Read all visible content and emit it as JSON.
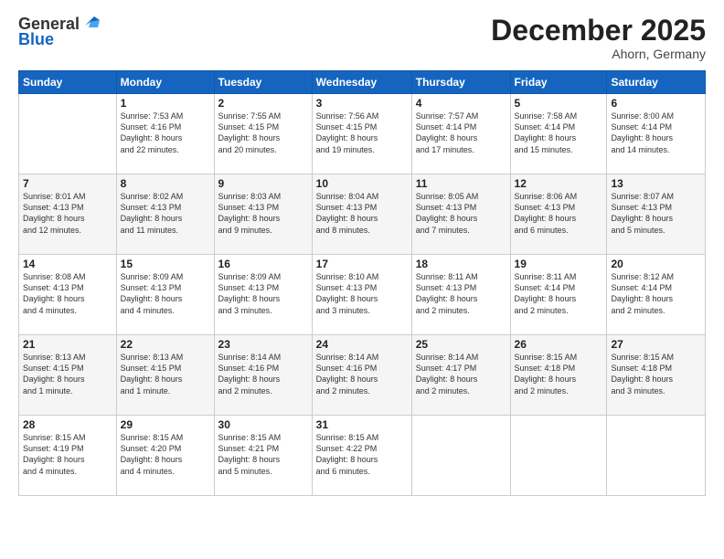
{
  "logo": {
    "line1": "General",
    "line2": "Blue"
  },
  "title": "December 2025",
  "location": "Ahorn, Germany",
  "days_of_week": [
    "Sunday",
    "Monday",
    "Tuesday",
    "Wednesday",
    "Thursday",
    "Friday",
    "Saturday"
  ],
  "weeks": [
    [
      {
        "num": "",
        "info": ""
      },
      {
        "num": "1",
        "info": "Sunrise: 7:53 AM\nSunset: 4:16 PM\nDaylight: 8 hours\nand 22 minutes."
      },
      {
        "num": "2",
        "info": "Sunrise: 7:55 AM\nSunset: 4:15 PM\nDaylight: 8 hours\nand 20 minutes."
      },
      {
        "num": "3",
        "info": "Sunrise: 7:56 AM\nSunset: 4:15 PM\nDaylight: 8 hours\nand 19 minutes."
      },
      {
        "num": "4",
        "info": "Sunrise: 7:57 AM\nSunset: 4:14 PM\nDaylight: 8 hours\nand 17 minutes."
      },
      {
        "num": "5",
        "info": "Sunrise: 7:58 AM\nSunset: 4:14 PM\nDaylight: 8 hours\nand 15 minutes."
      },
      {
        "num": "6",
        "info": "Sunrise: 8:00 AM\nSunset: 4:14 PM\nDaylight: 8 hours\nand 14 minutes."
      }
    ],
    [
      {
        "num": "7",
        "info": "Sunrise: 8:01 AM\nSunset: 4:13 PM\nDaylight: 8 hours\nand 12 minutes."
      },
      {
        "num": "8",
        "info": "Sunrise: 8:02 AM\nSunset: 4:13 PM\nDaylight: 8 hours\nand 11 minutes."
      },
      {
        "num": "9",
        "info": "Sunrise: 8:03 AM\nSunset: 4:13 PM\nDaylight: 8 hours\nand 9 minutes."
      },
      {
        "num": "10",
        "info": "Sunrise: 8:04 AM\nSunset: 4:13 PM\nDaylight: 8 hours\nand 8 minutes."
      },
      {
        "num": "11",
        "info": "Sunrise: 8:05 AM\nSunset: 4:13 PM\nDaylight: 8 hours\nand 7 minutes."
      },
      {
        "num": "12",
        "info": "Sunrise: 8:06 AM\nSunset: 4:13 PM\nDaylight: 8 hours\nand 6 minutes."
      },
      {
        "num": "13",
        "info": "Sunrise: 8:07 AM\nSunset: 4:13 PM\nDaylight: 8 hours\nand 5 minutes."
      }
    ],
    [
      {
        "num": "14",
        "info": "Sunrise: 8:08 AM\nSunset: 4:13 PM\nDaylight: 8 hours\nand 4 minutes."
      },
      {
        "num": "15",
        "info": "Sunrise: 8:09 AM\nSunset: 4:13 PM\nDaylight: 8 hours\nand 4 minutes."
      },
      {
        "num": "16",
        "info": "Sunrise: 8:09 AM\nSunset: 4:13 PM\nDaylight: 8 hours\nand 3 minutes."
      },
      {
        "num": "17",
        "info": "Sunrise: 8:10 AM\nSunset: 4:13 PM\nDaylight: 8 hours\nand 3 minutes."
      },
      {
        "num": "18",
        "info": "Sunrise: 8:11 AM\nSunset: 4:13 PM\nDaylight: 8 hours\nand 2 minutes."
      },
      {
        "num": "19",
        "info": "Sunrise: 8:11 AM\nSunset: 4:14 PM\nDaylight: 8 hours\nand 2 minutes."
      },
      {
        "num": "20",
        "info": "Sunrise: 8:12 AM\nSunset: 4:14 PM\nDaylight: 8 hours\nand 2 minutes."
      }
    ],
    [
      {
        "num": "21",
        "info": "Sunrise: 8:13 AM\nSunset: 4:15 PM\nDaylight: 8 hours\nand 1 minute."
      },
      {
        "num": "22",
        "info": "Sunrise: 8:13 AM\nSunset: 4:15 PM\nDaylight: 8 hours\nand 1 minute."
      },
      {
        "num": "23",
        "info": "Sunrise: 8:14 AM\nSunset: 4:16 PM\nDaylight: 8 hours\nand 2 minutes."
      },
      {
        "num": "24",
        "info": "Sunrise: 8:14 AM\nSunset: 4:16 PM\nDaylight: 8 hours\nand 2 minutes."
      },
      {
        "num": "25",
        "info": "Sunrise: 8:14 AM\nSunset: 4:17 PM\nDaylight: 8 hours\nand 2 minutes."
      },
      {
        "num": "26",
        "info": "Sunrise: 8:15 AM\nSunset: 4:18 PM\nDaylight: 8 hours\nand 2 minutes."
      },
      {
        "num": "27",
        "info": "Sunrise: 8:15 AM\nSunset: 4:18 PM\nDaylight: 8 hours\nand 3 minutes."
      }
    ],
    [
      {
        "num": "28",
        "info": "Sunrise: 8:15 AM\nSunset: 4:19 PM\nDaylight: 8 hours\nand 4 minutes."
      },
      {
        "num": "29",
        "info": "Sunrise: 8:15 AM\nSunset: 4:20 PM\nDaylight: 8 hours\nand 4 minutes."
      },
      {
        "num": "30",
        "info": "Sunrise: 8:15 AM\nSunset: 4:21 PM\nDaylight: 8 hours\nand 5 minutes."
      },
      {
        "num": "31",
        "info": "Sunrise: 8:15 AM\nSunset: 4:22 PM\nDaylight: 8 hours\nand 6 minutes."
      },
      {
        "num": "",
        "info": ""
      },
      {
        "num": "",
        "info": ""
      },
      {
        "num": "",
        "info": ""
      }
    ]
  ]
}
